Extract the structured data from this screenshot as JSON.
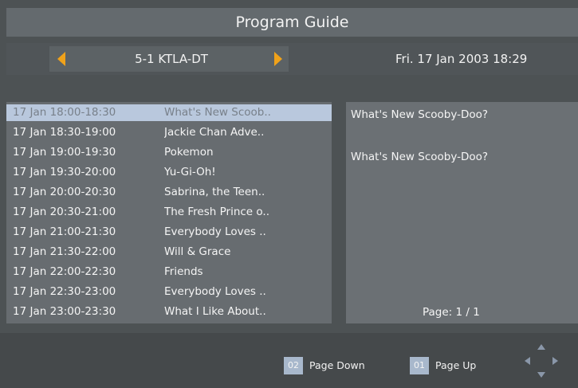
{
  "header": {
    "title": "Program Guide"
  },
  "channel": {
    "name": "5-1 KTLA-DT",
    "datetime": "Fri.  17 Jan 2003 18:29"
  },
  "schedule": {
    "items": [
      {
        "time": "17 Jan 18:00-18:30",
        "program": "What's New Scoob..",
        "selected": true
      },
      {
        "time": "17 Jan 18:30-19:00",
        "program": "Jackie Chan Adve.."
      },
      {
        "time": "17 Jan 19:00-19:30",
        "program": "Pokemon"
      },
      {
        "time": "17 Jan 19:30-20:00",
        "program": "Yu-Gi-Oh!"
      },
      {
        "time": "17 Jan 20:00-20:30",
        "program": "Sabrina, the Teen.."
      },
      {
        "time": "17 Jan 20:30-21:00",
        "program": "The Fresh Prince o.."
      },
      {
        "time": "17 Jan 21:00-21:30",
        "program": "Everybody Loves .."
      },
      {
        "time": "17 Jan 21:30-22:00",
        "program": "Will & Grace"
      },
      {
        "time": "17 Jan 22:00-22:30",
        "program": "Friends"
      },
      {
        "time": "17 Jan 22:30-23:00",
        "program": "Everybody Loves .."
      },
      {
        "time": "17 Jan 23:00-23:30",
        "program": "What I Like About.."
      }
    ]
  },
  "info": {
    "title": "What's New Scooby-Doo?",
    "description": "What's New Scooby-Doo?",
    "page": "Page:  1 / 1"
  },
  "footer": {
    "page_down_key": "02",
    "page_down_label": "Page Down",
    "page_up_key": "01",
    "page_up_label": "Page Up"
  },
  "icons": {
    "left": "left-arrow-icon",
    "right": "right-arrow-icon",
    "nav": "navigation-cross-icon"
  },
  "colors": {
    "accent": "#f0a21a",
    "selection": "#b9c8dd",
    "key_badge": "#a8b8cc"
  }
}
